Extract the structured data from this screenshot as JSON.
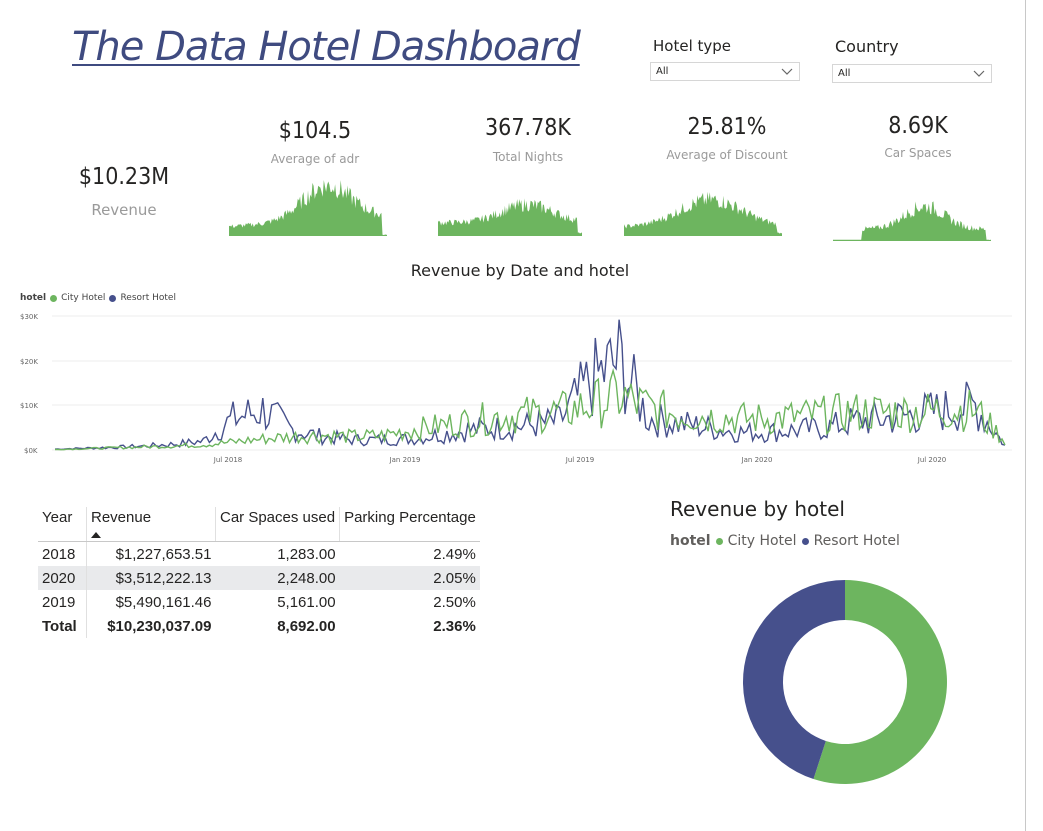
{
  "title": "The Data Hotel Dashboard",
  "slicers": {
    "hotel_type": {
      "label": "Hotel type",
      "value": "All"
    },
    "country": {
      "label": "Country",
      "value": "All"
    }
  },
  "kpis": {
    "revenue": {
      "value": "$10.23M",
      "label": "Revenue"
    },
    "adr": {
      "value": "$104.5",
      "label": "Average of adr"
    },
    "nights": {
      "value": "367.78K",
      "label": "Total Nights"
    },
    "discount": {
      "value": "25.81%",
      "label": "Average of Discount"
    },
    "car": {
      "value": "8.69K",
      "label": "Car Spaces"
    }
  },
  "colors": {
    "city": "#6db55f",
    "resort": "#46508c",
    "accent": "#3f4b80"
  },
  "line_chart": {
    "title": "Revenue by Date and hotel",
    "legend_title": "hotel",
    "series_names": [
      "City Hotel",
      "Resort Hotel"
    ],
    "y_ticks": [
      "$30K",
      "$20K",
      "$10K",
      "$0K"
    ],
    "x_ticks": [
      "Jul 2018",
      "Jan 2019",
      "Jul 2019",
      "Jan 2020",
      "Jul 2020"
    ]
  },
  "chart_data": [
    {
      "type": "line",
      "title": "Revenue by Date and hotel",
      "xlabel": "",
      "ylabel": "",
      "ylim": [
        0,
        30000
      ],
      "x": [
        "2018-01",
        "2018-02",
        "2018-03",
        "2018-04",
        "2018-05",
        "2018-06",
        "2018-07",
        "2018-08",
        "2018-09",
        "2018-10",
        "2018-11",
        "2018-12",
        "2019-01",
        "2019-02",
        "2019-03",
        "2019-04",
        "2019-05",
        "2019-06",
        "2019-07",
        "2019-08",
        "2019-09",
        "2019-10",
        "2019-11",
        "2019-12",
        "2020-01",
        "2020-02",
        "2020-03",
        "2020-04",
        "2020-05",
        "2020-06",
        "2020-07",
        "2020-08",
        "2020-09"
      ],
      "series": [
        {
          "name": "City Hotel",
          "values": [
            100,
            300,
            500,
            700,
            900,
            1200,
            1800,
            2500,
            3000,
            3300,
            3000,
            3200,
            4500,
            5500,
            6500,
            7500,
            8000,
            8500,
            10000,
            12000,
            9500,
            8000,
            7500,
            7000,
            7000,
            7500,
            8000,
            8500,
            8500,
            8500,
            9000,
            9000,
            2000
          ]
        },
        {
          "name": "Resort Hotel",
          "values": [
            200,
            400,
            600,
            900,
            1300,
            2000,
            7000,
            9000,
            4500,
            3000,
            2300,
            2300,
            2500,
            3500,
            4500,
            5000,
            5500,
            6500,
            15000,
            20000,
            7000,
            6000,
            5000,
            4000,
            4000,
            4500,
            5000,
            6500,
            7000,
            8000,
            9000,
            10000,
            1000
          ]
        }
      ],
      "grid": true,
      "legend": "top-left"
    },
    {
      "type": "table",
      "columns": [
        "Year",
        "Revenue",
        "Car Spaces used",
        "Parking Percentage"
      ],
      "rows": [
        [
          "2018",
          "$1,227,653.51",
          "1,283.00",
          "2.49%"
        ],
        [
          "2020",
          "$3,512,222.13",
          "2,248.00",
          "2.05%"
        ],
        [
          "2019",
          "$5,490,161.46",
          "5,161.00",
          "2.50%"
        ]
      ],
      "total": [
        "Total",
        "$10,230,037.09",
        "8,692.00",
        "2.36%"
      ]
    },
    {
      "type": "pie",
      "title": "Revenue by hotel",
      "categories": [
        "City Hotel",
        "Resort Hotel"
      ],
      "values": [
        0.55,
        0.45
      ],
      "legend": "top-left"
    }
  ],
  "table": {
    "headers": [
      "Year",
      "Revenue",
      "Car Spaces used",
      "Parking Percentage"
    ],
    "rows": [
      {
        "year": "2018",
        "revenue": "$1,227,653.51",
        "car": "1,283.00",
        "pct": "2.49%"
      },
      {
        "year": "2020",
        "revenue": "$3,512,222.13",
        "car": "2,248.00",
        "pct": "2.05%"
      },
      {
        "year": "2019",
        "revenue": "$5,490,161.46",
        "car": "5,161.00",
        "pct": "2.50%"
      }
    ],
    "total": {
      "year": "Total",
      "revenue": "$10,230,037.09",
      "car": "8,692.00",
      "pct": "2.36%"
    }
  },
  "donut": {
    "title": "Revenue by hotel",
    "legend_title": "hotel",
    "items": [
      "City Hotel",
      "Resort Hotel"
    ]
  }
}
